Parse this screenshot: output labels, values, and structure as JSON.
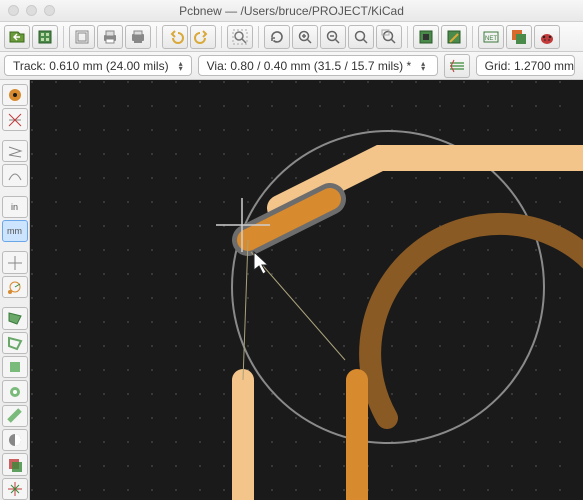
{
  "titlebar": {
    "app": "Pcbnew",
    "path": "/Users/bruce/PROJECT/KiCad"
  },
  "trackbar": {
    "track_label": "Track: 0.610 mm (24.00 mils)",
    "via_label": "Via: 0.80 / 0.40 mm (31.5 / 15.7 mils) *",
    "grid_label": "Grid: 1.2700 mm"
  },
  "left_tools": {
    "in_label": "in",
    "mm_label": "mm"
  },
  "toolbar_icons": [
    "open-icon",
    "footprint-icon",
    "layer-icon",
    "print-icon",
    "plot-icon",
    "undo-icon",
    "redo-icon",
    "zoom-fit-icon",
    "refresh-icon",
    "zoom-in-icon",
    "zoom-out-icon",
    "zoom-window-icon",
    "zoom-select-icon",
    "drc-icon",
    "footprint-editor-icon",
    "net-inspector-icon",
    "3d-icon",
    "bug-icon"
  ],
  "colors": {
    "track_light": "#f3c58b",
    "track_orange": "#d88a2e",
    "track_brown": "#8a5a24",
    "outline": "#a0a0a0",
    "grid_dot": "#4a4a4a"
  }
}
